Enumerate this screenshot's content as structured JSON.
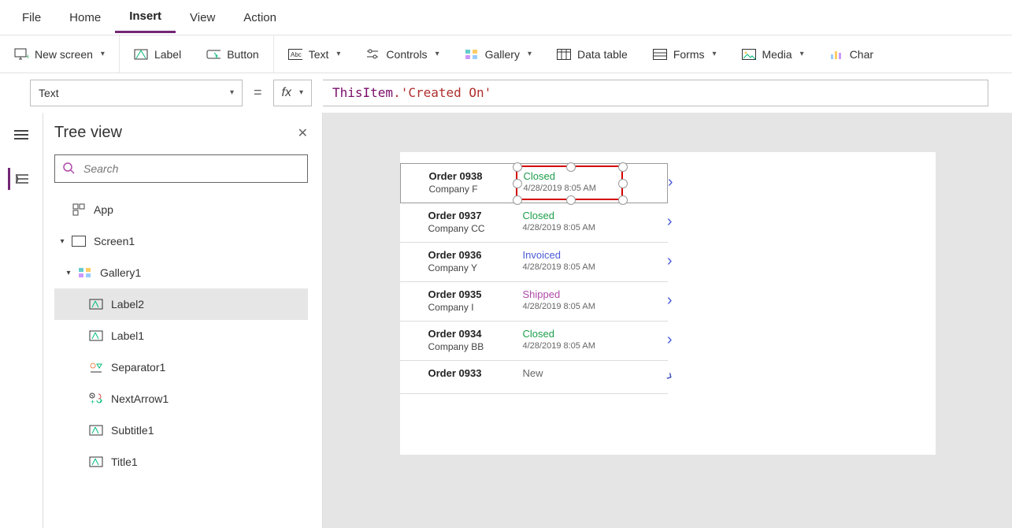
{
  "menubar": [
    "File",
    "Home",
    "Insert",
    "View",
    "Action"
  ],
  "menubar_active": "Insert",
  "ribbon": {
    "new_screen": "New screen",
    "label": "Label",
    "button": "Button",
    "text": "Text",
    "controls": "Controls",
    "gallery": "Gallery",
    "data_table": "Data table",
    "forms": "Forms",
    "media": "Media",
    "chart": "Char"
  },
  "property_selector": "Text",
  "formula_tokens": {
    "obj": "ThisItem",
    "prop": ".'Created On'"
  },
  "tree": {
    "title": "Tree view",
    "search_placeholder": "Search",
    "items": [
      {
        "name": "App",
        "icon": "app",
        "indent": 0
      },
      {
        "name": "Screen1",
        "icon": "screen",
        "indent": 0,
        "expanded": true
      },
      {
        "name": "Gallery1",
        "icon": "gallery",
        "indent": 1,
        "expanded": true
      },
      {
        "name": "Label2",
        "icon": "label",
        "indent": 2,
        "selected": true
      },
      {
        "name": "Label1",
        "icon": "label",
        "indent": 2
      },
      {
        "name": "Separator1",
        "icon": "separator",
        "indent": 2
      },
      {
        "name": "NextArrow1",
        "icon": "nextarrow",
        "indent": 2
      },
      {
        "name": "Subtitle1",
        "icon": "label",
        "indent": 2
      },
      {
        "name": "Title1",
        "icon": "label",
        "indent": 2
      }
    ]
  },
  "gallery_items": [
    {
      "title": "Order 0938",
      "sub": "Company F",
      "status": "Closed",
      "date": "4/28/2019 8:05 AM",
      "selected": true
    },
    {
      "title": "Order 0937",
      "sub": "Company CC",
      "status": "Closed",
      "date": "4/28/2019 8:05 AM"
    },
    {
      "title": "Order 0936",
      "sub": "Company Y",
      "status": "Invoiced",
      "date": "4/28/2019 8:05 AM"
    },
    {
      "title": "Order 0935",
      "sub": "Company I",
      "status": "Shipped",
      "date": "4/28/2019 8:05 AM"
    },
    {
      "title": "Order 0934",
      "sub": "Company BB",
      "status": "Closed",
      "date": "4/28/2019 8:05 AM"
    },
    {
      "title": "Order 0933",
      "sub": "",
      "status": "New",
      "date": ""
    }
  ]
}
